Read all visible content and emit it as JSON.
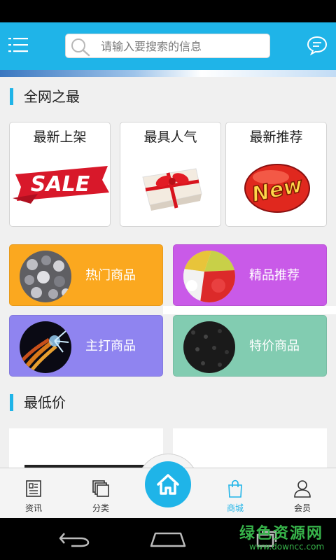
{
  "header": {
    "search_placeholder": "请输入要搜索的信息"
  },
  "sections": {
    "best_title": "全网之最",
    "lowest_title": "最低价"
  },
  "promo_cards": [
    {
      "label": "最新上架",
      "image": "sale-banner"
    },
    {
      "label": "最具人气",
      "image": "gift-box"
    },
    {
      "label": "最新推荐",
      "image": "new-badge"
    }
  ],
  "categories": [
    {
      "label": "热门商品",
      "color": "#fba81f",
      "image": "crowd-photo"
    },
    {
      "label": "精品推荐",
      "color": "#c95ae8",
      "image": "colored-pellets"
    },
    {
      "label": "主打商品",
      "color": "#8f84f0",
      "image": "cable-wires"
    },
    {
      "label": "特价商品",
      "color": "#82ccb1",
      "image": "black-granules"
    }
  ],
  "tabs": [
    {
      "label": "资讯",
      "icon": "news-icon",
      "active": false
    },
    {
      "label": "分类",
      "icon": "category-icon",
      "active": false
    },
    {
      "label": "商城",
      "icon": "shopping-bag-icon",
      "active": true
    },
    {
      "label": "会员",
      "icon": "user-icon",
      "active": false
    }
  ],
  "watermark": {
    "title": "绿色资源网",
    "url": "www.downcc.com"
  },
  "colors": {
    "accent": "#1fb4e8"
  }
}
